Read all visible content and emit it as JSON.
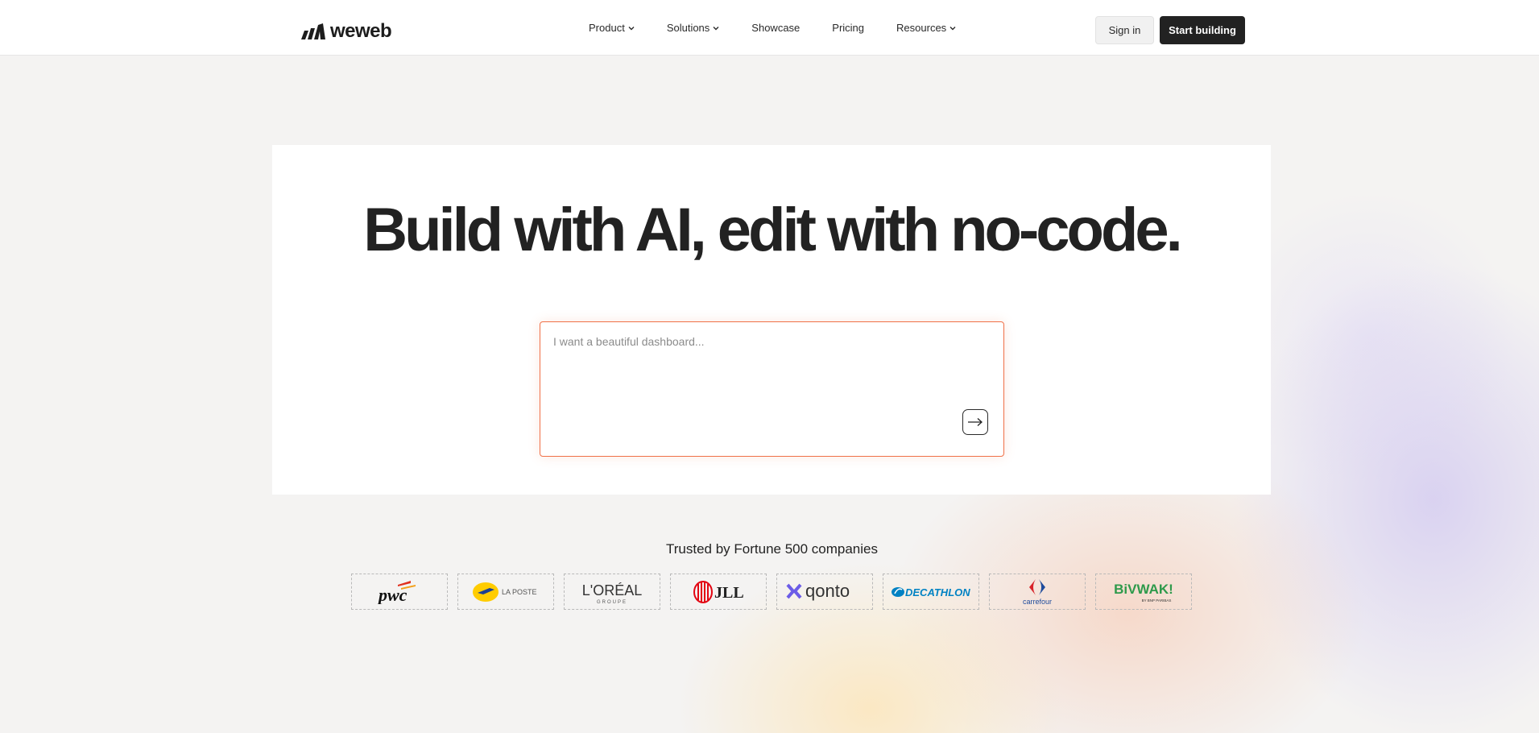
{
  "brand": {
    "name": "weweb",
    "logo_icon": "weweb-logo-icon"
  },
  "nav": {
    "items": [
      {
        "label": "Product",
        "dropdown": true
      },
      {
        "label": "Solutions",
        "dropdown": true
      },
      {
        "label": "Showcase",
        "dropdown": false
      },
      {
        "label": "Pricing",
        "dropdown": false
      },
      {
        "label": "Resources",
        "dropdown": true
      }
    ],
    "sign_in": "Sign in",
    "start_building": "Start building"
  },
  "hero": {
    "headline": "Build with AI, edit with no-code.",
    "prompt_placeholder": "I want a beautiful dashboard...",
    "send_icon": "arrow-right-icon"
  },
  "trusted": {
    "heading": "Trusted by Fortune 500 companies",
    "logos": [
      {
        "name": "pwc",
        "text": "pwc"
      },
      {
        "name": "la-poste",
        "text": "LA POSTE"
      },
      {
        "name": "loreal",
        "text": "L'ORÉAL",
        "sub": "GROUPE"
      },
      {
        "name": "jll",
        "text": "JLL"
      },
      {
        "name": "qonto",
        "text": "qonto"
      },
      {
        "name": "decathlon",
        "text": "DECATHLON"
      },
      {
        "name": "carrefour",
        "text": "carrefour"
      },
      {
        "name": "bivwak",
        "text": "BiVWAK!",
        "sub": "BY BNP PARIBAS"
      }
    ]
  },
  "colors": {
    "accent_border": "#f07148",
    "dark_button": "#222222",
    "qonto_purple": "#6b5ce7",
    "jll_red": "#e30613",
    "decathlon_blue": "#0082c3",
    "carrefour_blue": "#1e4b9c",
    "carrefour_red": "#d8232a",
    "bivwak_green": "#2e9a4b",
    "laposte_yellow": "#ffcc00",
    "pwc_orange": "#e0301e"
  }
}
